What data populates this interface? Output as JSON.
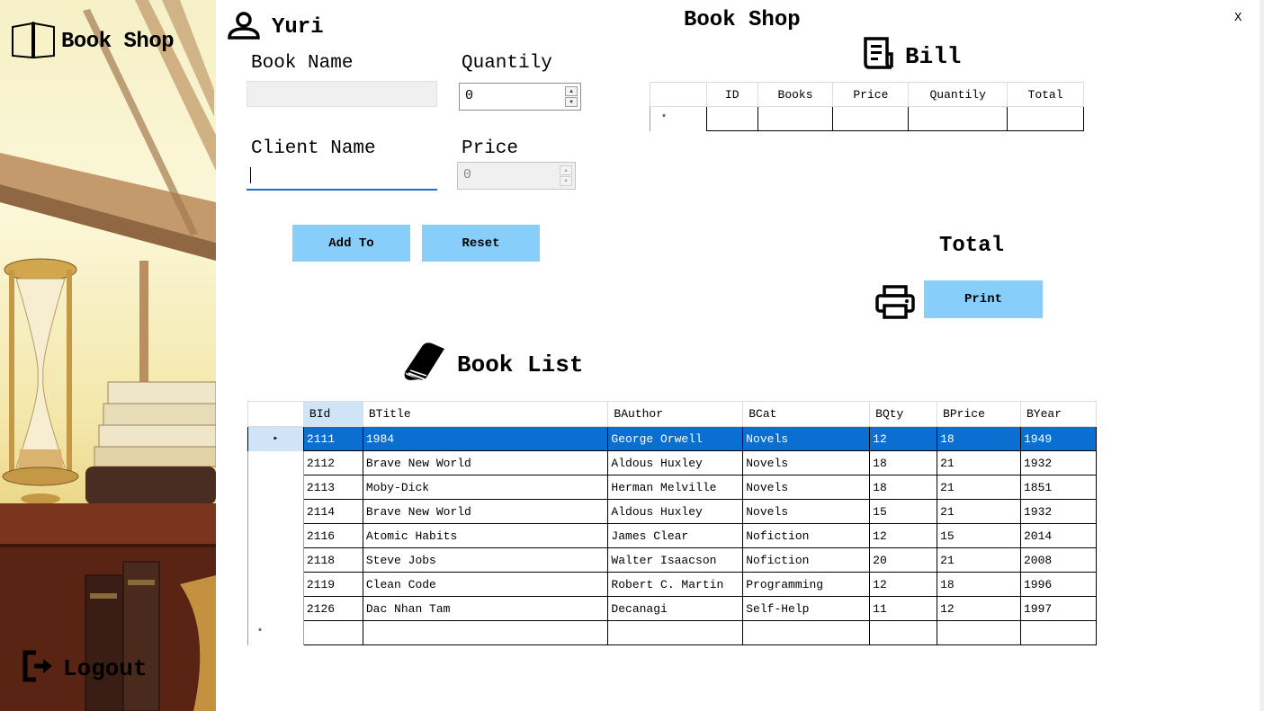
{
  "sidebar": {
    "title": "Book Shop",
    "logout_label": "Logout"
  },
  "window": {
    "close_label": "X",
    "title": "Book Shop"
  },
  "user": {
    "name": "Yuri"
  },
  "form": {
    "book_name_label": "Book Name",
    "book_name_value": "",
    "quantity_label": "Quantily",
    "quantity_value": "0",
    "client_name_label": "Client Name",
    "client_name_value": "",
    "price_label": "Price",
    "price_value": "0",
    "add_button": "Add To",
    "reset_button": "Reset"
  },
  "bill": {
    "title": "Bill",
    "columns": [
      "ID",
      "Books",
      "Price",
      "Quantily",
      "Total"
    ],
    "new_row_marker": "*"
  },
  "total": {
    "label": "Total",
    "print_button": "Print"
  },
  "book_list": {
    "title": "Book List",
    "columns": [
      "BId",
      "BTitle",
      "BAuthor",
      "BCat",
      "BQty",
      "BPrice",
      "BYear"
    ],
    "rows": [
      [
        "2111",
        "1984",
        "George Orwell",
        "Novels",
        "12",
        "18",
        "1949"
      ],
      [
        "2112",
        "Brave New World",
        "Aldous Huxley",
        "Novels",
        "18",
        "21",
        "1932"
      ],
      [
        "2113",
        "Moby-Dick",
        "Herman Melville",
        "Novels",
        "18",
        "21",
        "1851"
      ],
      [
        "2114",
        "Brave New World",
        "Aldous Huxley",
        "Novels",
        "15",
        "21",
        "1932"
      ],
      [
        "2116",
        "Atomic Habits",
        "James Clear",
        "Nofiction",
        "12",
        "15",
        "2014"
      ],
      [
        "2118",
        "Steve Jobs",
        "Walter Isaacson",
        "Nofiction",
        "20",
        "21",
        "2008"
      ],
      [
        "2119",
        "Clean Code",
        "Robert C. Martin",
        "Programming",
        "12",
        "18",
        "1996"
      ],
      [
        "2126",
        "Dac Nhan Tam",
        "Decanagi",
        "Self-Help",
        "11",
        "12",
        "1997"
      ]
    ],
    "selected_row": 0,
    "selected_marker": "▸",
    "new_row_marker": "*"
  },
  "colors": {
    "button": "#87cefa",
    "selection": "#0a6fd0",
    "header_selected": "#cfe4f7",
    "input_focus": "#1a73c8"
  },
  "icons": {
    "sidebar_title": "open-book-icon",
    "logout": "logout-icon",
    "user": "user-icon",
    "bill": "receipt-icon",
    "print": "printer-icon",
    "book_list": "book-icon"
  }
}
